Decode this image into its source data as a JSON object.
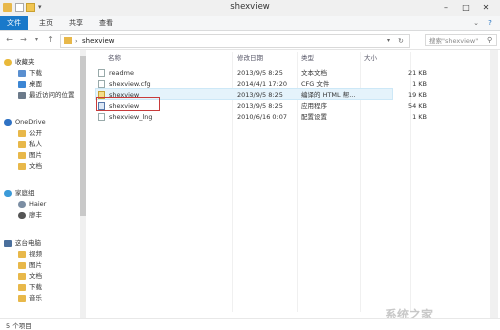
{
  "window": {
    "title": "shexview"
  },
  "ribbon": {
    "tabs": [
      "文件",
      "主页",
      "共享",
      "查看"
    ]
  },
  "nav": {
    "path": "shexview",
    "search_placeholder": "搜索\"shexview\""
  },
  "sidebar": {
    "groups": [
      {
        "label": "收藏夹",
        "items": [
          "下载",
          "桌面",
          "最近访问的位置"
        ]
      },
      {
        "label": "OneDrive",
        "items": [
          "公开",
          "私人",
          "图片",
          "文档"
        ]
      },
      {
        "label": "家庭组",
        "items": [
          "Haier",
          "廖丰"
        ]
      },
      {
        "label": "这台电脑",
        "items": [
          "视频",
          "图片",
          "文档",
          "下载",
          "音乐"
        ]
      }
    ]
  },
  "columns": {
    "name": "名称",
    "date": "修改日期",
    "type": "类型",
    "size": "大小"
  },
  "files": [
    {
      "name": "readme",
      "date": "2013/9/5 8:25",
      "type": "文本文档",
      "size": "21 KB"
    },
    {
      "name": "shexview.cfg",
      "date": "2014/4/1 17:20",
      "type": "CFG 文件",
      "size": "1 KB"
    },
    {
      "name": "shexview",
      "date": "2013/9/5 8:25",
      "type": "编译的 HTML 帮...",
      "size": "19 KB"
    },
    {
      "name": "shexview",
      "date": "2013/9/5 8:25",
      "type": "应用程序",
      "size": "54 KB"
    },
    {
      "name": "shexview_lng",
      "date": "2010/6/16 0:07",
      "type": "配置设置",
      "size": "1 KB"
    }
  ],
  "status": {
    "count": "5 个项目"
  },
  "watermark": {
    "text": "系统之家"
  }
}
